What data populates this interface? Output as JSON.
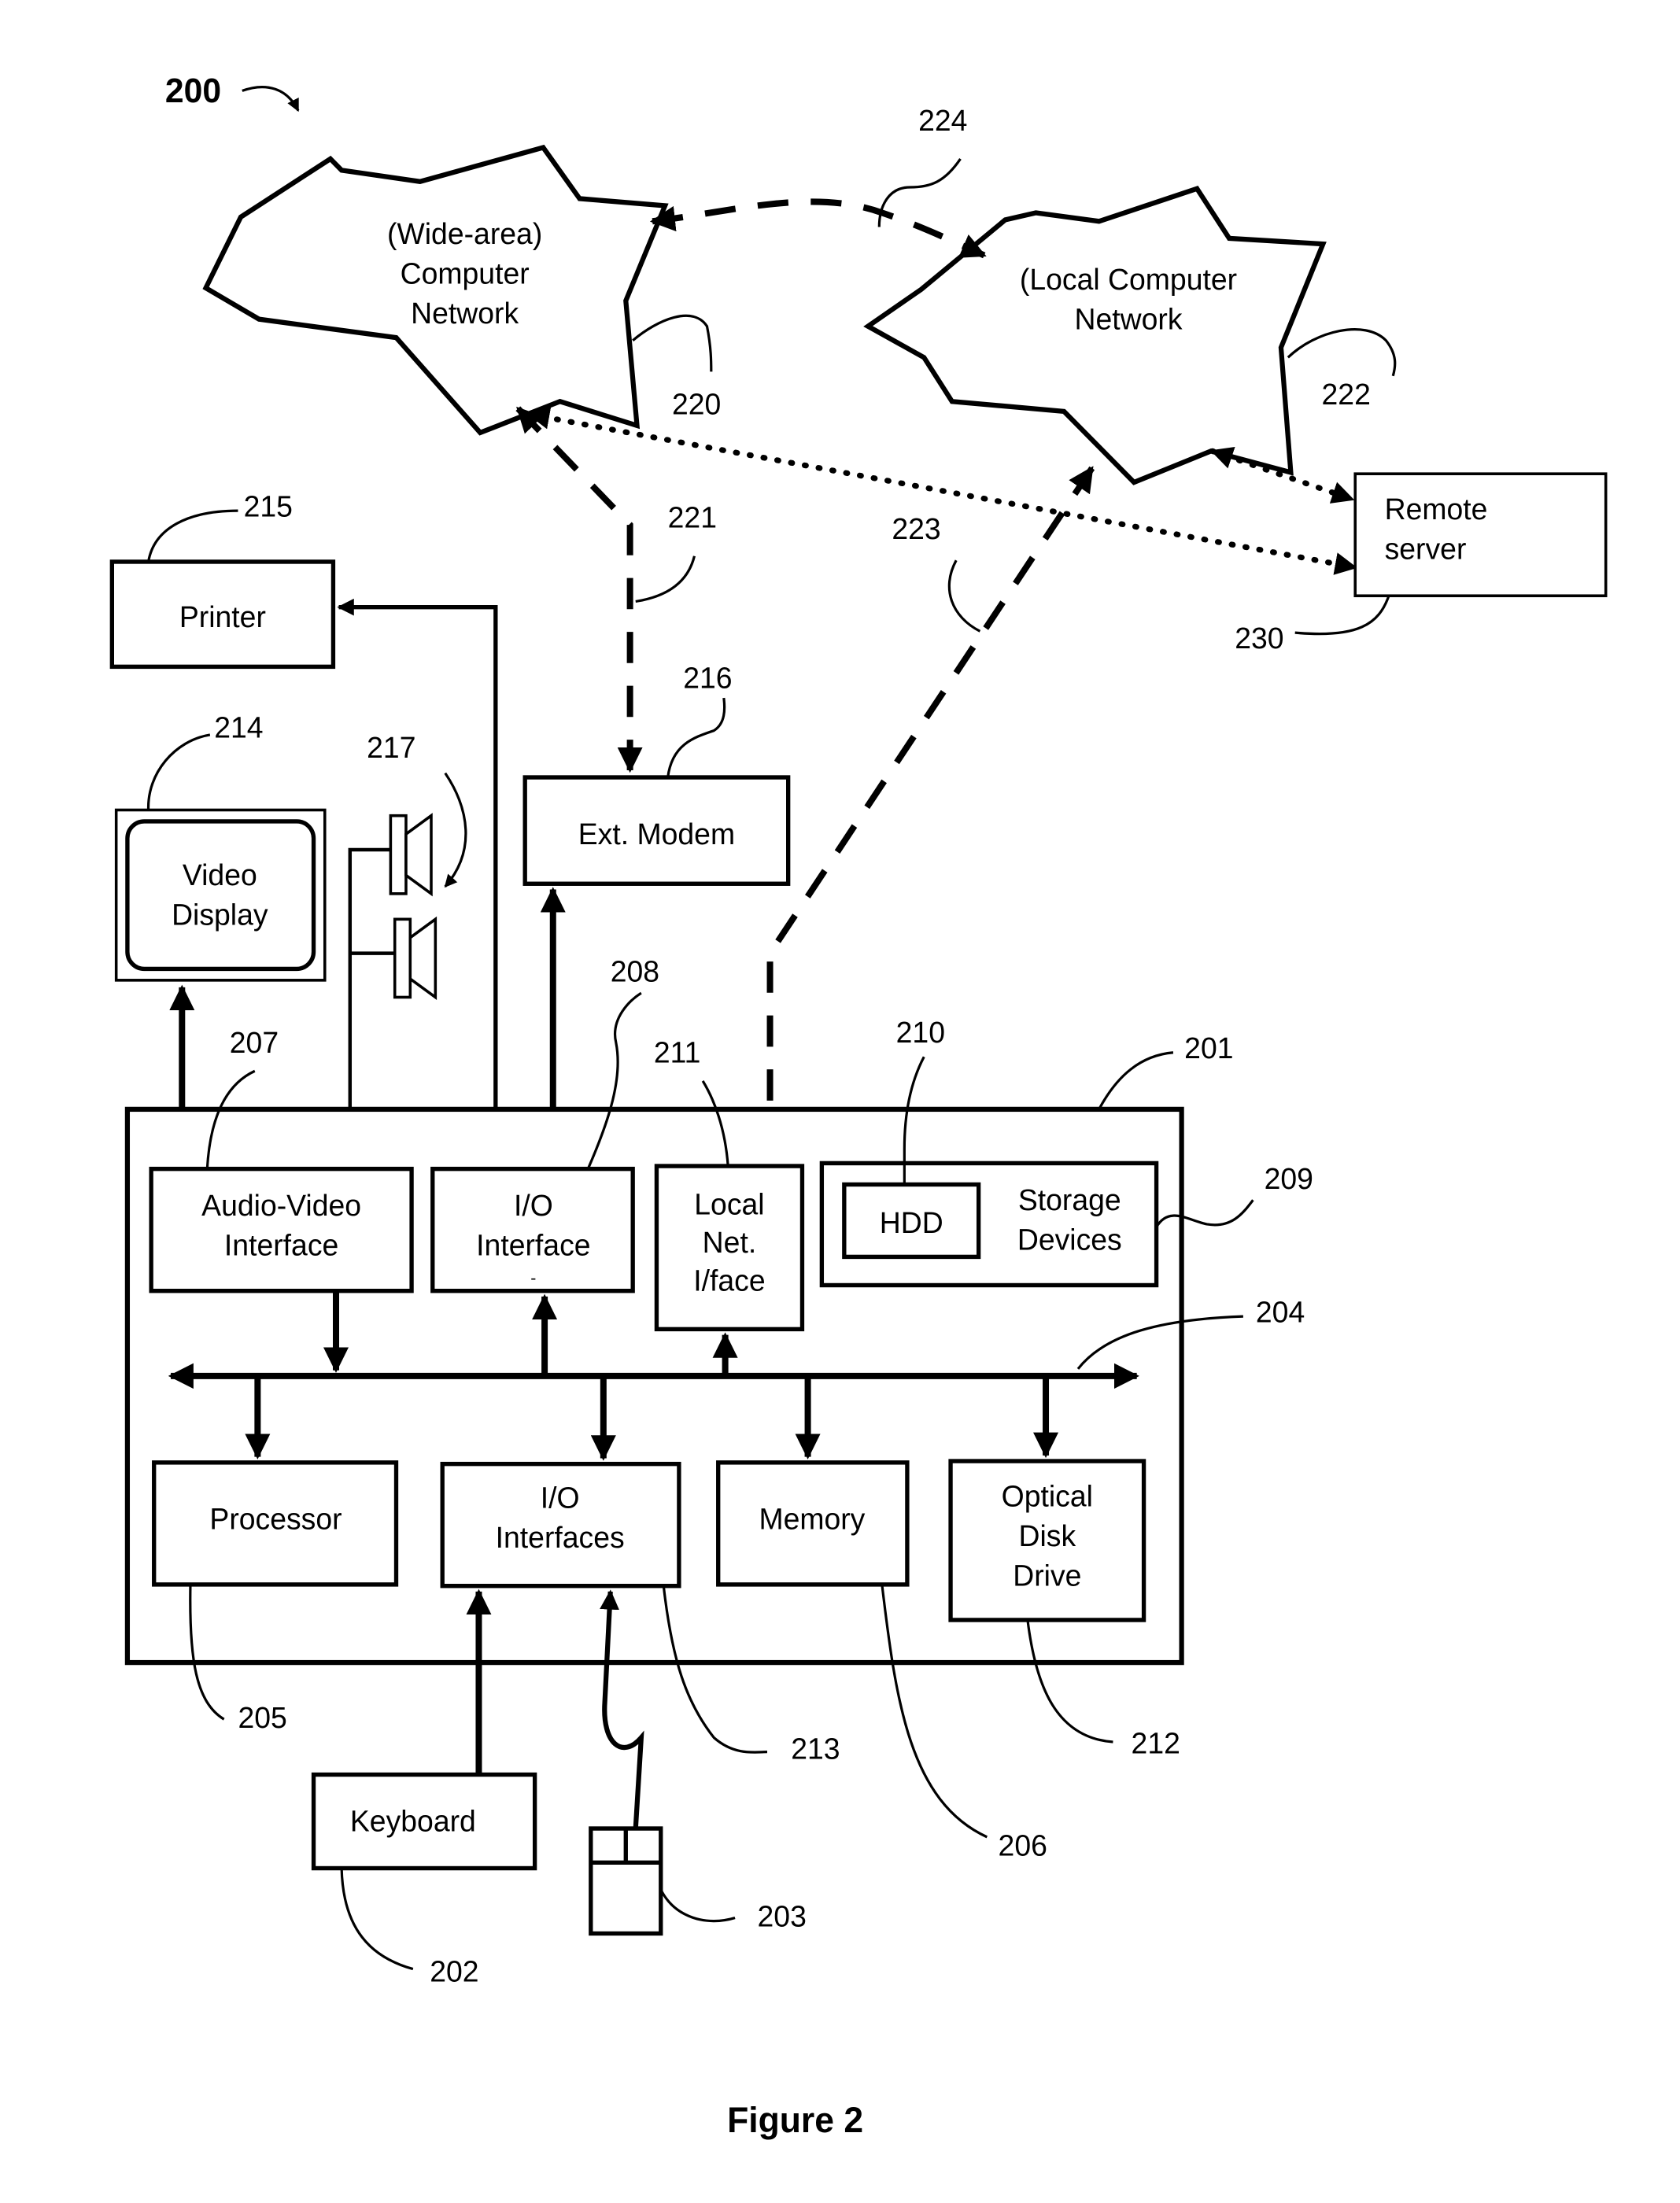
{
  "figure": {
    "ref": "200",
    "caption": "Figure 2"
  },
  "networks": {
    "wan": {
      "lines": [
        "(Wide-area)",
        "Computer",
        "Network"
      ],
      "ref": "220"
    },
    "lan": {
      "lines": [
        "(Local Computer",
        "Network"
      ],
      "ref": "222"
    }
  },
  "connections": {
    "wan_lan": "224",
    "wan_modem": "221",
    "lan_local_net": "223"
  },
  "remote_server": {
    "lines": [
      "Remote",
      "server"
    ],
    "ref": "230"
  },
  "peripherals": {
    "printer": {
      "label": "Printer",
      "ref": "215"
    },
    "video_display": {
      "lines": [
        "Video",
        "Display"
      ],
      "ref": "214"
    },
    "speakers": {
      "ref": "217"
    },
    "ext_modem": {
      "label": "Ext. Modem",
      "ref": "216"
    },
    "keyboard": {
      "label": "Keyboard",
      "ref": "202"
    },
    "mouse": {
      "ref": "203"
    }
  },
  "computer": {
    "ref": "201",
    "bus_ref": "204",
    "modules": {
      "av_interface": {
        "lines": [
          "Audio-Video",
          "Interface"
        ],
        "ref": "207"
      },
      "io_interface": {
        "lines": [
          "I/O",
          "Interface",
          "-"
        ],
        "ref": "208"
      },
      "local_net": {
        "lines": [
          "Local",
          "Net.",
          "I/face"
        ],
        "ref": "211"
      },
      "storage": {
        "label_lines": [
          "Storage",
          "Devices"
        ],
        "hdd": "HDD",
        "ref": "209",
        "hdd_ref": "210"
      },
      "processor": {
        "label": "Processor",
        "ref": "205"
      },
      "io_interfaces": {
        "lines": [
          "I/O",
          "Interfaces"
        ],
        "ref": "213"
      },
      "memory": {
        "label": "Memory",
        "ref": "206"
      },
      "optical": {
        "lines": [
          "Optical",
          "Disk",
          "Drive"
        ],
        "ref": "212"
      }
    }
  }
}
